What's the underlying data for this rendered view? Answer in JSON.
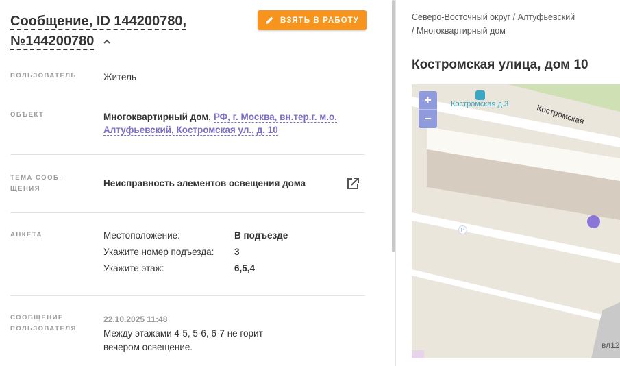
{
  "header": {
    "title_line1": "Сообщение, ID 144200780,",
    "title_line2": "№144200780",
    "take_button": "ВЗЯТЬ В РАБОТУ"
  },
  "fields": {
    "user_label": "ПОЛЬЗОВАТЕЛЬ",
    "user_value": "Житель",
    "object_label": "ОБЪЕКТ",
    "object_type": "Многоквартирный дом,",
    "object_address_1": "РФ, г. Москва, вн.тер.г. м.о.",
    "object_address_2": "Алтуфьевский, Костромская ул., д. 10",
    "topic_label_1": "ТЕМА СООБ-",
    "topic_label_2": "ЩЕНИЯ",
    "topic_value": "Неисправность элементов освещения дома",
    "survey_label": "АНКЕТА",
    "survey": [
      {
        "q": "Местоположение:",
        "a": "В подъезде"
      },
      {
        "q": "Укажите номер подъезда:",
        "a": "3"
      },
      {
        "q": "Укажите этаж:",
        "a": "6,5,4"
      }
    ],
    "message_label_1": "СООБЩЕНИЕ",
    "message_label_2": "ПОЛЬЗОВАТЕЛЯ",
    "message_time": "22.10.2025 11:48",
    "message_text": "Между этажами 4-5, 5-6, 6-7 не горит вечером освещение."
  },
  "right": {
    "breadcrumb_1": "Северо-Восточный округ / Алтуфьевский",
    "breadcrumb_2": "/ Многоквартирный дом",
    "address_title": "Костромская улица, дом 10"
  },
  "map": {
    "zoom_in": "+",
    "zoom_out": "−",
    "stop_label": "Костромская д.3",
    "street_label": "Костромская",
    "building_number": "вл12",
    "parking_label": "P",
    "pin_color": "#8a76d9",
    "zoom_color": "#8f9bdc"
  },
  "colors": {
    "accent": "#f7941d",
    "link": "#7b6fc6"
  }
}
